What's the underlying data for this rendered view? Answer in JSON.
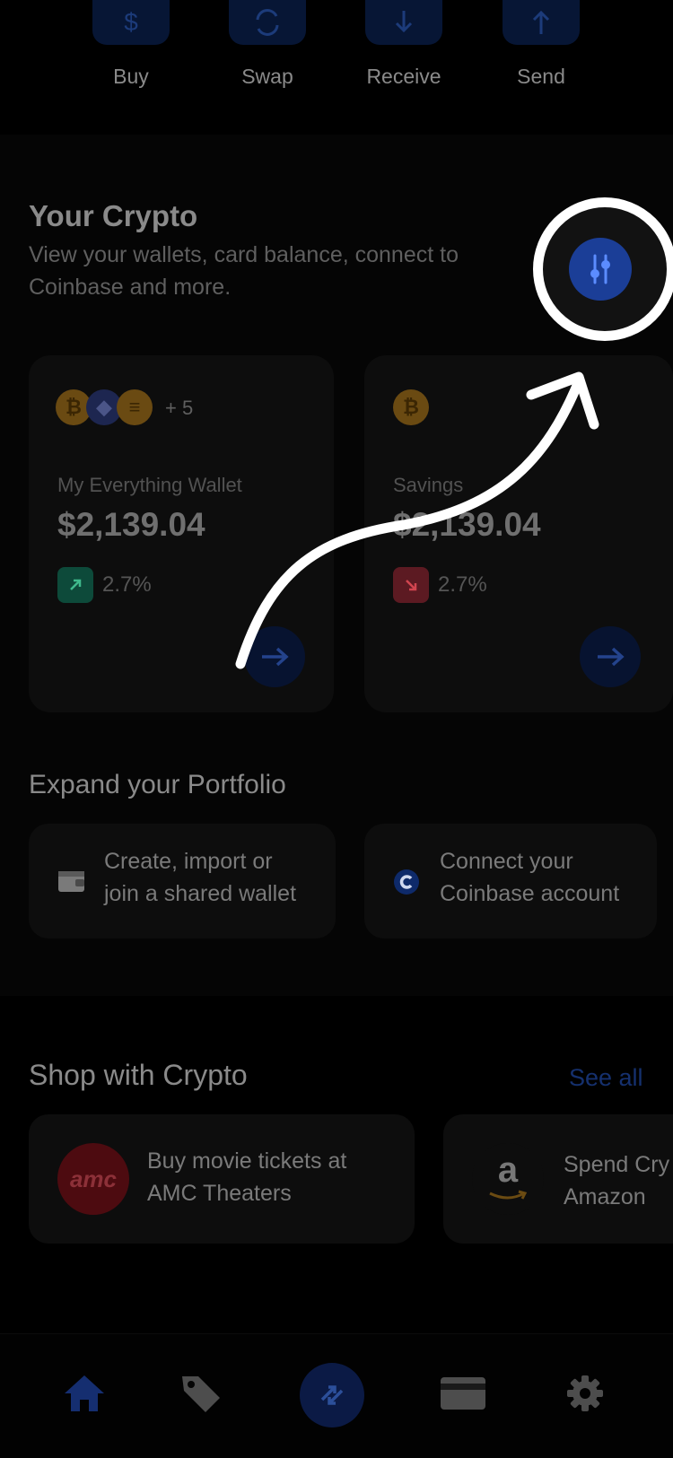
{
  "actions": [
    {
      "label": "Buy",
      "icon": "dollar-icon"
    },
    {
      "label": "Swap",
      "icon": "swap-icon"
    },
    {
      "label": "Receive",
      "icon": "arrow-down-icon"
    },
    {
      "label": "Send",
      "icon": "arrow-up-icon"
    }
  ],
  "crypto": {
    "title": "Your Crypto",
    "subtitle_line1": "View your wallets, card balance, connect to",
    "subtitle_line2": "Coinbase and more."
  },
  "wallets": [
    {
      "extra_coins": "+ 5",
      "name": "My Everything Wallet",
      "balance": "$2,139.04",
      "change": "2.7%",
      "trend": "up"
    },
    {
      "name": "Savings",
      "balance": "$2,139.04",
      "change": "2.7%",
      "trend": "down"
    }
  ],
  "expand": {
    "title": "Expand your Portfolio",
    "cards": [
      {
        "line1": "Create, import or",
        "line2": "join a shared wallet",
        "icon": "wallet-icon"
      },
      {
        "line1": "Connect your",
        "line2": "Coinbase account",
        "icon": "coinbase-icon"
      }
    ]
  },
  "shop": {
    "title": "Shop with Crypto",
    "see_all": "See all",
    "cards": [
      {
        "logo_text": "amc",
        "line1": "Buy movie tickets at",
        "line2": "AMC Theaters",
        "icon": "amc-logo"
      },
      {
        "logo_text": "a",
        "line1": "Spend Cry",
        "line2": "Amazon",
        "icon": "amazon-logo"
      }
    ]
  },
  "nav": [
    "home-icon",
    "tag-icon",
    "swap-icon",
    "card-icon",
    "settings-icon"
  ],
  "colors": {
    "accent": "#3a6cf0",
    "dim_accent": "#0b1a45",
    "green": "#0d4a3a",
    "red": "#5c1a22",
    "overlay_white": "#ffffff"
  }
}
